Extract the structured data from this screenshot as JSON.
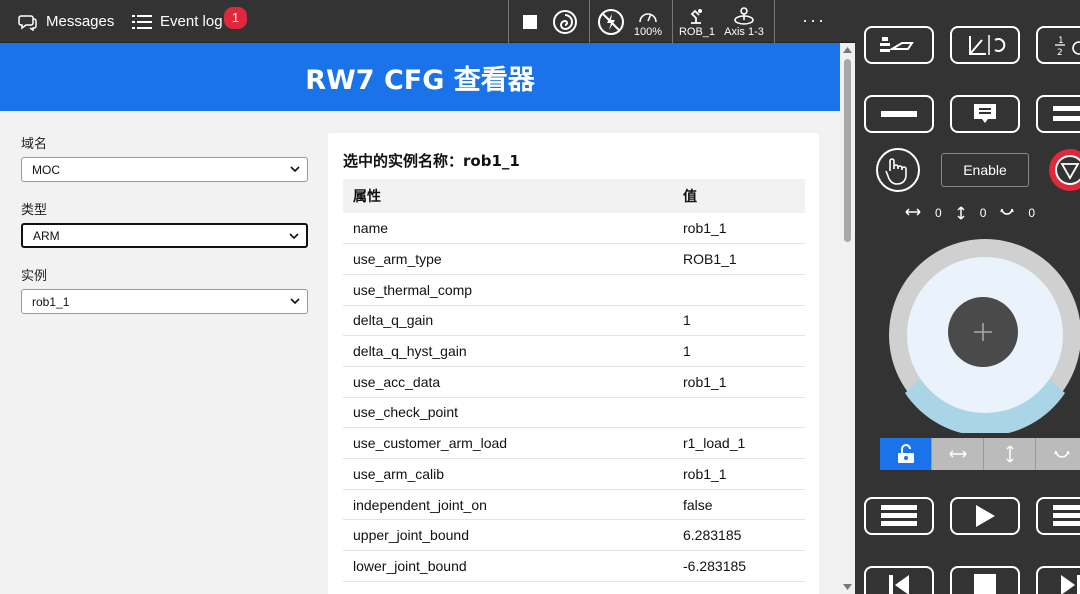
{
  "topbar": {
    "messages_label": "Messages",
    "eventlog_label": "Event log",
    "eventlog_badge": "1",
    "speed": "100%",
    "robot": "ROB_1",
    "axis": "Axis 1-3",
    "more": "···"
  },
  "page": {
    "title": "RW7 CFG 查看器"
  },
  "form": {
    "domain_label": "域名",
    "domain_value": "MOC",
    "type_label": "类型",
    "type_value": "ARM",
    "instance_label": "实例",
    "instance_value": "rob1_1"
  },
  "detail": {
    "title": "选中的实例名称：rob1_1",
    "headers": [
      "属性",
      "值"
    ],
    "rows": [
      [
        "name",
        "rob1_1"
      ],
      [
        "use_arm_type",
        "ROB1_1"
      ],
      [
        "use_thermal_comp",
        ""
      ],
      [
        "delta_q_gain",
        "1"
      ],
      [
        "delta_q_hyst_gain",
        "1"
      ],
      [
        "use_acc_data",
        "rob1_1"
      ],
      [
        "use_check_point",
        ""
      ],
      [
        "use_customer_arm_load",
        "r1_load_1"
      ],
      [
        "use_arm_calib",
        "rob1_1"
      ],
      [
        "independent_joint_on",
        "false"
      ],
      [
        "upper_joint_bound",
        "6.283185"
      ],
      [
        "lower_joint_bound",
        "-6.283185"
      ]
    ]
  },
  "pendant": {
    "enable_label": "Enable",
    "axis_values": [
      "0",
      "0",
      "0"
    ],
    "colors": {
      "accent": "#1a73e8",
      "stop": "#e0283c",
      "panel": "#333333"
    }
  }
}
